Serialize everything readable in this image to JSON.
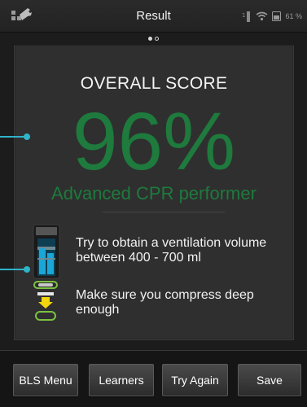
{
  "header": {
    "title": "Result",
    "battery": "61 %"
  },
  "pager": {
    "pages": 2,
    "current": 1
  },
  "result": {
    "score_label": "OVERALL SCORE",
    "score_value": "96%",
    "rating": "Advanced CPR performer"
  },
  "tips": [
    {
      "text": "Try to obtain a ventilation volume between 400 - 700 ml",
      "icon": "ventilation-gauge-icon"
    },
    {
      "text": "Make sure you compress deep enough",
      "icon": "compression-depth-icon"
    }
  ],
  "buttons": {
    "bls_menu": "BLS Menu",
    "learners": "Learners",
    "try_again": "Try Again",
    "save": "Save"
  },
  "colors": {
    "score_green": "#1e7a3d",
    "pointer_cyan": "#2fb3c9",
    "gauge_blue": "#1aa7d8",
    "compress_green": "#7cc142",
    "arrow_yellow": "#f2d40f"
  }
}
